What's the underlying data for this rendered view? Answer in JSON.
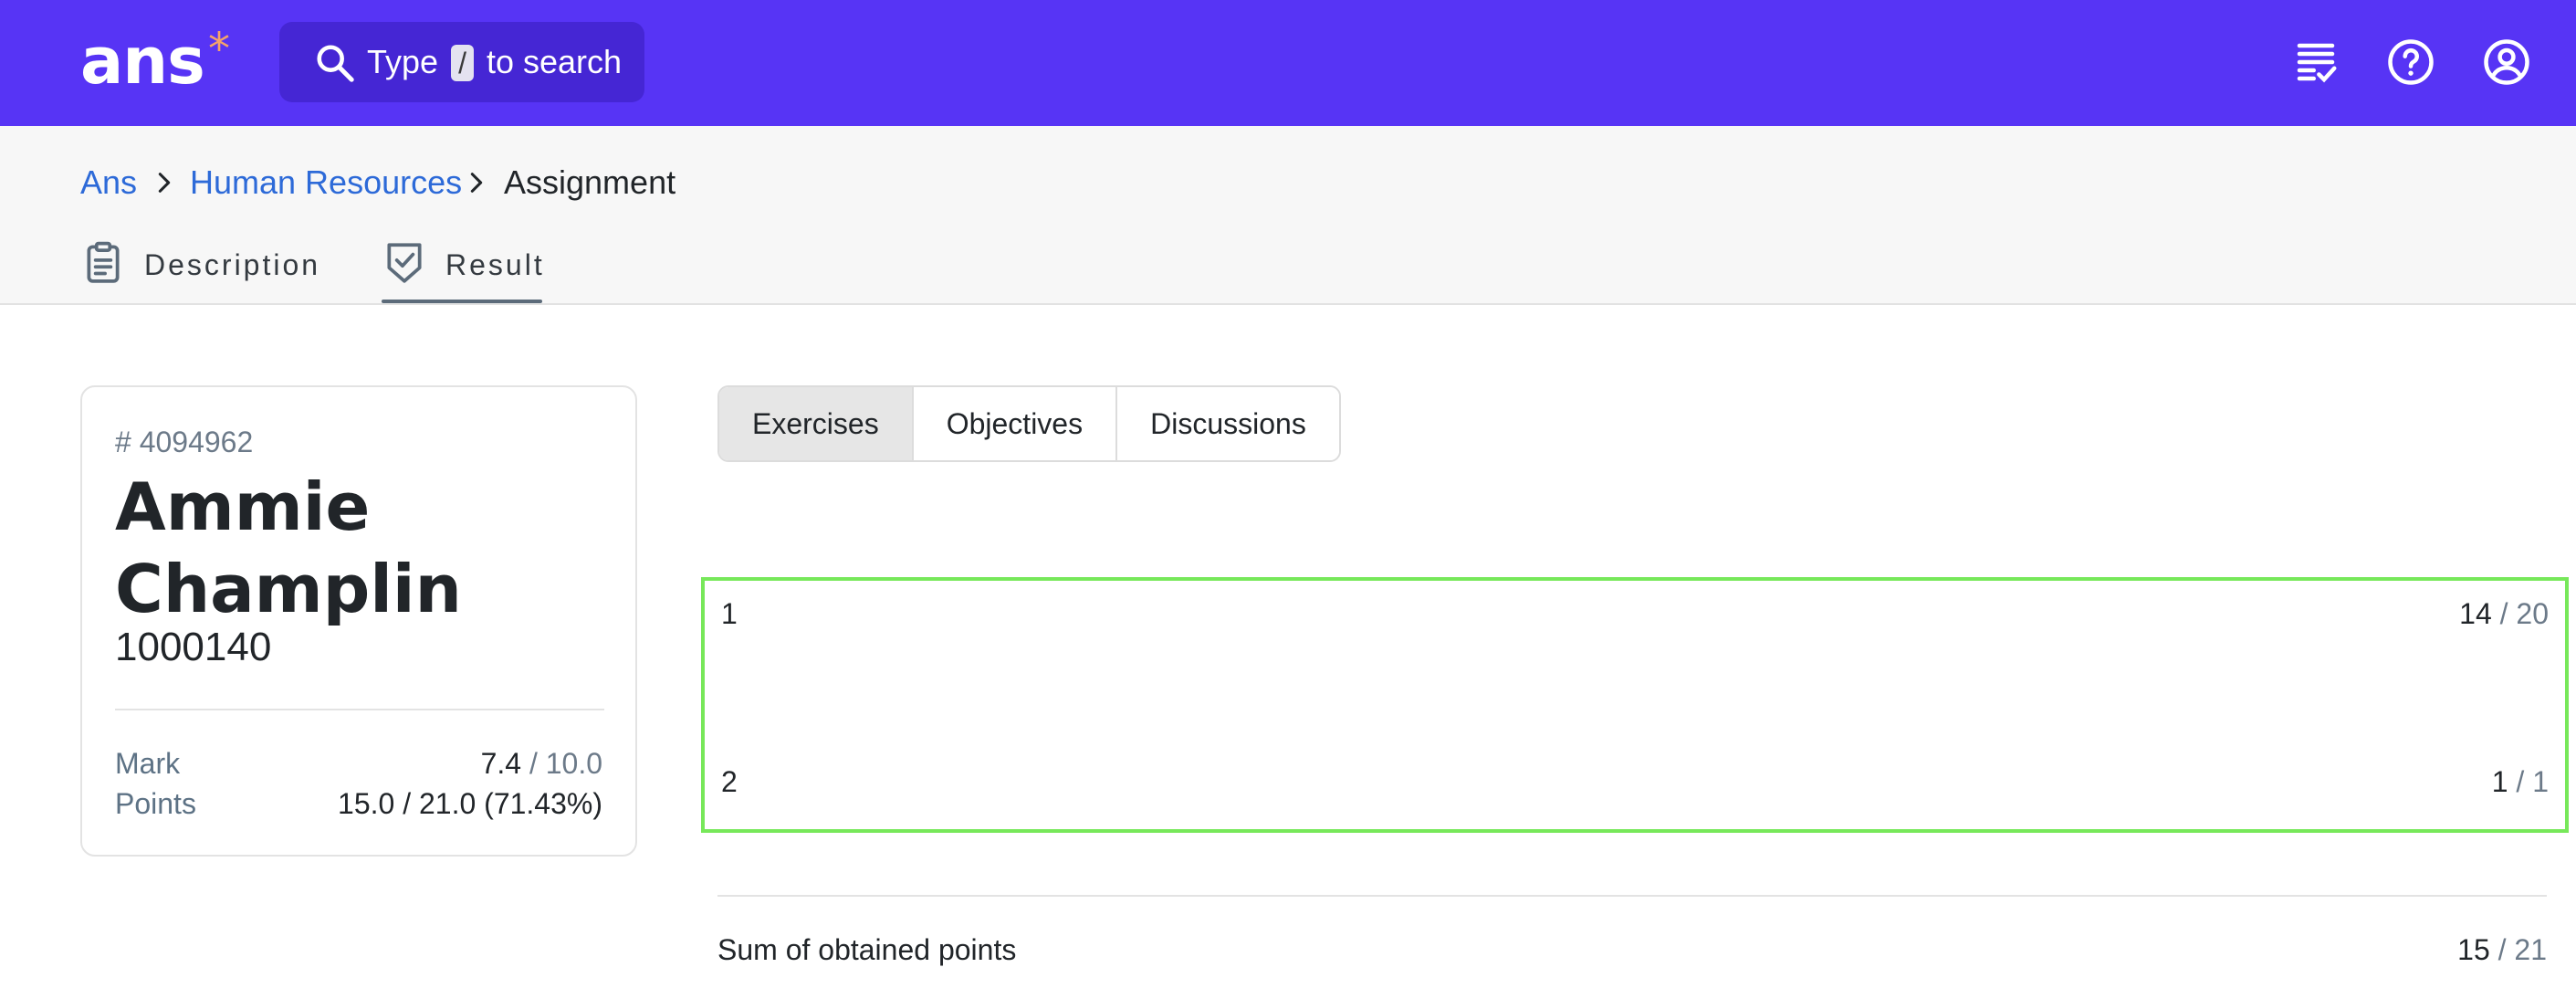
{
  "app": {
    "logo_text": "ans",
    "logo_mark": "*"
  },
  "search": {
    "prefix": "Type",
    "shortcut": "/",
    "suffix": "to search"
  },
  "header_icons": [
    "checklist-icon",
    "help-icon",
    "account-icon"
  ],
  "breadcrumb": [
    {
      "label": "Ans",
      "link": true
    },
    {
      "label": "Human Resources",
      "link": true
    },
    {
      "label": "Assignment",
      "link": false
    }
  ],
  "tabs": [
    {
      "label": "Description",
      "icon": "clipboard-icon",
      "active": false
    },
    {
      "label": "Result",
      "icon": "shield-check-icon",
      "active": true
    }
  ],
  "student": {
    "id_label": "# 4094962",
    "name": "Ammie Champlin",
    "number": "1000140",
    "mark_label": "Mark",
    "mark_value": "7.4",
    "mark_max": "/ 10.0",
    "points_label": "Points",
    "points_value": "15.0 / 21.0 (71.43%)"
  },
  "segments": [
    {
      "label": "Exercises",
      "active": true
    },
    {
      "label": "Objectives",
      "active": false
    },
    {
      "label": "Discussions",
      "active": false
    }
  ],
  "exercises": [
    {
      "number": "1",
      "obtained": "14",
      "total": "/ 20"
    },
    {
      "number": "2",
      "obtained": "1",
      "total": "/ 1"
    }
  ],
  "sum": {
    "label": "Sum of obtained points",
    "obtained": "15",
    "total": "/ 21"
  },
  "colors": {
    "brand": "#5734f5",
    "link": "#2d6ad8",
    "highlight": "#77e85a",
    "logo_mark": "#f5a36a"
  }
}
